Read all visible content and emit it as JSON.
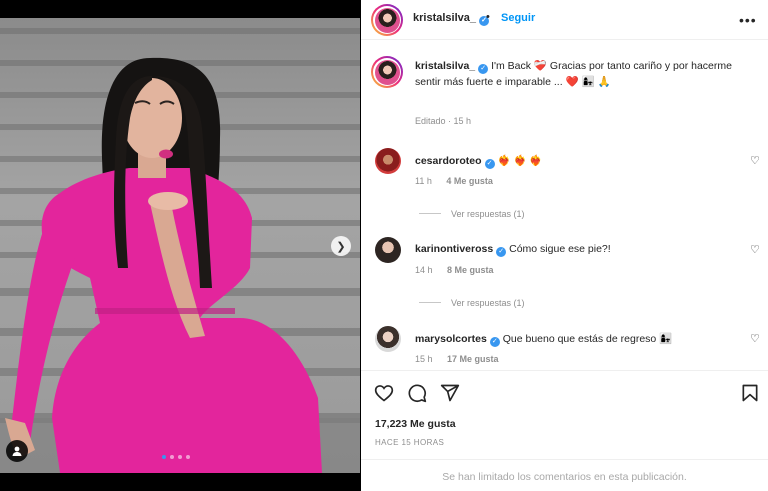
{
  "post": {
    "username": "kristalsilva_",
    "follow_label": "Seguir",
    "header_separator": "•",
    "more_label": "•••"
  },
  "caption": {
    "username": "kristalsilva_",
    "text": "I'm Back ❤️‍🩹 Gracias por tanto cariño y por hacerme sentir más fuerte e imparable ... ❤️ 👩‍👧 🙏",
    "edited": "Editado · 15 h"
  },
  "comments": [
    {
      "username": "cesardoroteo",
      "text": "❤️‍🔥 ❤️‍🔥 ❤️‍🔥",
      "time": "11 h",
      "likes": "4 Me gusta",
      "replies": "Ver respuestas (1)"
    },
    {
      "username": "karinontiveross",
      "text": "Cómo sigue ese pie?!",
      "time": "14 h",
      "likes": "8 Me gusta",
      "replies": "Ver respuestas (1)"
    },
    {
      "username": "marysolcortes",
      "text": "Que bueno que estás de regreso 👩‍👧",
      "time": "15 h",
      "likes": "17 Me gusta"
    }
  ],
  "actions": {
    "likes": "17,223 Me gusta",
    "time_ago": "HACE 15 HORAS",
    "limited_notice": "Se han limitado los comentarios en esta publicación."
  },
  "carousel": {
    "count": 4,
    "active_index": 0
  },
  "colors": {
    "accent": "#0095f6",
    "verified": "#3897f0",
    "dress": "#e3259c"
  },
  "icons": [
    "heart-icon",
    "comment-icon",
    "share-icon",
    "bookmark-icon",
    "user-tag-icon",
    "chevron-right-icon",
    "verified-badge-icon"
  ]
}
